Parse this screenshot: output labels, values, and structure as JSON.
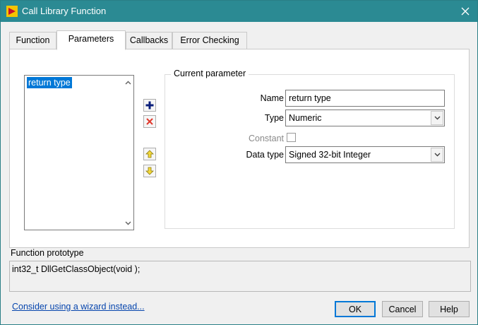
{
  "window": {
    "title": "Call Library Function",
    "accent_color": "#2b8a93"
  },
  "tabs": [
    {
      "label": "Function"
    },
    {
      "label": "Parameters"
    },
    {
      "label": "Callbacks"
    },
    {
      "label": "Error Checking"
    }
  ],
  "active_tab": "Parameters",
  "parameters": {
    "list": [
      {
        "label": "return type",
        "selected": true
      }
    ]
  },
  "current_parameter": {
    "legend": "Current parameter",
    "name_label": "Name",
    "name_value": "return type",
    "type_label": "Type",
    "type_value": "Numeric",
    "constant_label": "Constant",
    "constant_checked": false,
    "data_type_label": "Data type",
    "data_type_value": "Signed 32-bit Integer"
  },
  "prototype": {
    "label": "Function prototype",
    "text": "int32_t DllGetClassObject(void );"
  },
  "footer": {
    "wizard_link": "Consider using a wizard instead...",
    "ok_label": "OK",
    "cancel_label": "Cancel",
    "help_label": "Help"
  },
  "icons": {
    "title": "labview-arrow-icon",
    "close": "close-icon",
    "add": "plus-icon",
    "delete": "delete-x-icon",
    "move_up": "arrow-up-icon",
    "move_down": "arrow-down-icon"
  }
}
